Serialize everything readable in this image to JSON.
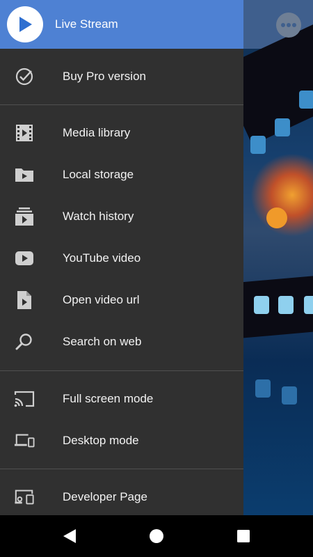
{
  "header": {
    "title": "Live Stream",
    "logo_icon": "play-icon",
    "accent": "#4e81d3"
  },
  "menu": {
    "pro": {
      "label": "Buy Pro version",
      "icon": "check-circle-icon"
    },
    "media": [
      {
        "label": "Media library",
        "icon": "film-icon"
      },
      {
        "label": "Local storage",
        "icon": "folder-play-icon"
      },
      {
        "label": "Watch history",
        "icon": "history-stack-icon"
      },
      {
        "label": "YouTube video",
        "icon": "youtube-icon"
      },
      {
        "label": "Open video url",
        "icon": "file-play-icon"
      },
      {
        "label": "Search on web",
        "icon": "search-icon"
      }
    ],
    "modes": [
      {
        "label": "Full screen mode",
        "icon": "cast-icon"
      },
      {
        "label": "Desktop mode",
        "icon": "devices-icon"
      }
    ],
    "dev": {
      "label": "Developer Page",
      "icon": "developer-devices-icon"
    }
  },
  "navbar": {
    "back_icon": "back-icon",
    "home_icon": "home-icon",
    "recents_icon": "recents-icon"
  },
  "colors": {
    "drawer_bg": "#303030",
    "icon": "#cfcfcf",
    "text": "#f2f2f2"
  }
}
